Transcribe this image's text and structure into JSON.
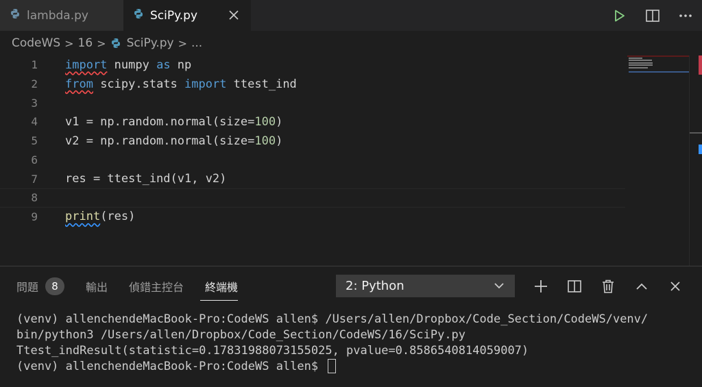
{
  "tabs": [
    {
      "label": "lambda.py",
      "icon": "python-icon",
      "active": false
    },
    {
      "label": "SciPy.py",
      "icon": "python-icon",
      "active": true
    }
  ],
  "tab_actions": [
    "run-icon",
    "split-editor-icon",
    "more-icon"
  ],
  "breadcrumb": {
    "items": [
      "CodeWS",
      "16",
      "SciPy.py",
      "..."
    ]
  },
  "editor": {
    "lines": [
      {
        "num": "1"
      },
      {
        "num": "2"
      },
      {
        "num": "3"
      },
      {
        "num": "4"
      },
      {
        "num": "5"
      },
      {
        "num": "6"
      },
      {
        "num": "7"
      },
      {
        "num": "8"
      },
      {
        "num": "9"
      }
    ],
    "code": {
      "l1a": "import",
      "l1b": " numpy ",
      "l1c": "as",
      "l1d": " np",
      "l2a": "from",
      "l2b": " scipy.stats ",
      "l2c": "import",
      "l2d": " ttest_ind",
      "l4a": "v1 = np.random.normal(size=",
      "l4b": "100",
      "l4c": ")",
      "l5a": "v2 = np.random.normal(size=",
      "l5b": "100",
      "l5c": ")",
      "l7": "res = ttest_ind(v1, v2)",
      "l9a": "print",
      "l9b": "(res)"
    }
  },
  "panel": {
    "tabs": {
      "problems": "問題",
      "problems_count": "8",
      "output": "輸出",
      "debug_console": "偵錯主控台",
      "terminal": "終端機"
    },
    "terminal_select": "2: Python",
    "actions": [
      "plus-icon",
      "split-terminal-icon",
      "trash-icon",
      "chevron-up-icon",
      "close-icon"
    ]
  },
  "terminal": {
    "line1": "(venv) allenchendeMacBook-Pro:CodeWS allen$ /Users/allen/Dropbox/Code_Section/CodeWS/venv/",
    "line2": "bin/python3 /Users/allen/Dropbox/Code_Section/CodeWS/16/SciPy.py",
    "line3": "Ttest_indResult(statistic=0.17831988073155025, pvalue=0.8586540814059007)",
    "line4": "(venv) allenchendeMacBook-Pro:CodeWS allen$ "
  },
  "colors": {
    "background": "#1e1e1e",
    "keyword": "#569cd6",
    "number": "#b5cea8",
    "run": "#89d185",
    "error": "#f14c4c"
  }
}
